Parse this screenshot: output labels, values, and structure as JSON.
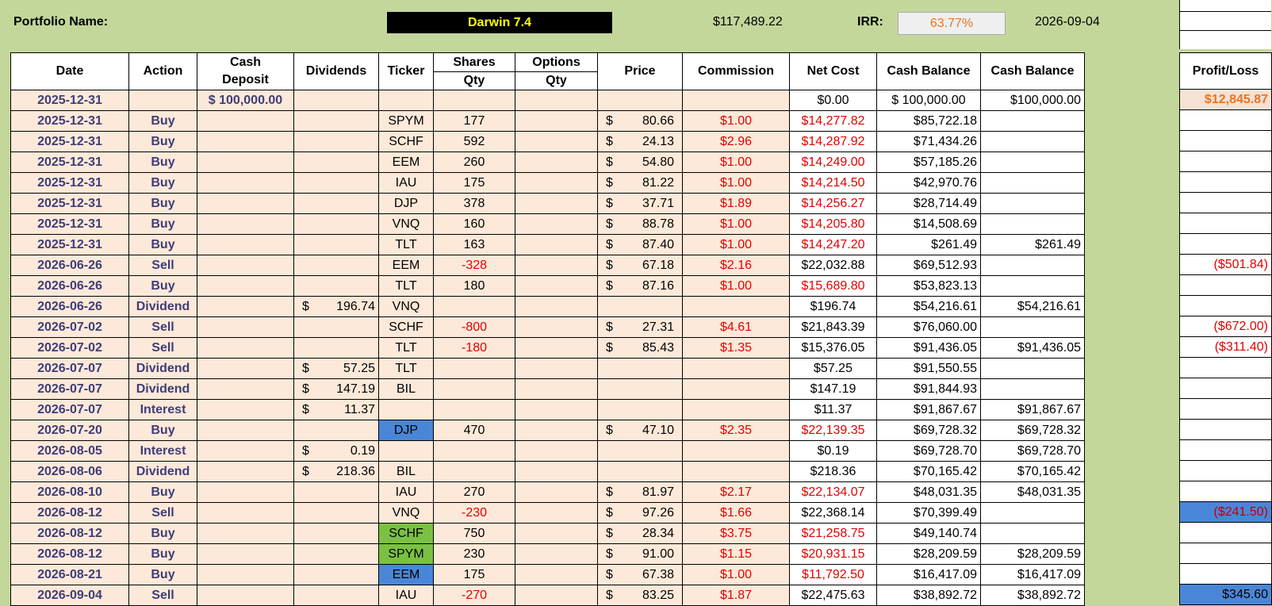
{
  "header": {
    "portfolio_label": "Portfolio Name:",
    "portfolio_name": "Darwin 7.4",
    "total_value": "$117,489.22",
    "irr_label": "IRR:",
    "irr_value": "63.77%",
    "report_date": "2026-09-04"
  },
  "columns": {
    "date": "Date",
    "action": "Action",
    "cash_deposit_1": "Cash",
    "cash_deposit_2": "Deposit",
    "dividends": "Dividends",
    "ticker": "Ticker",
    "shares_1": "Shares",
    "shares_2": "Qty",
    "options_1": "Options",
    "options_2": "Qty",
    "price": "Price",
    "commission": "Commission",
    "net_cost": "Net Cost",
    "cash_balance_1": "Cash Balance",
    "cash_balance_2": "Cash Balance",
    "profit_loss": "Profit/Loss"
  },
  "currency_symbol": "$",
  "rows": [
    {
      "date": "2025-12-31",
      "action": "",
      "deposit": "$ 100,000.00",
      "div": "",
      "ticker": "",
      "shares": "",
      "options": "",
      "price": "",
      "commission": "",
      "net_cost": "$0.00",
      "cash1": "$  100,000.00",
      "cash2": "$100,000.00",
      "pl": "$12,845.87"
    },
    {
      "date": "2025-12-31",
      "action": "Buy",
      "deposit": "",
      "div": "",
      "ticker": "SPYM",
      "shares": "177",
      "options": "",
      "price": "80.66",
      "commission": "$1.00",
      "net_cost": "$14,277.82",
      "cash1": "$85,722.18",
      "cash2": "",
      "pl": ""
    },
    {
      "date": "2025-12-31",
      "action": "Buy",
      "deposit": "",
      "div": "",
      "ticker": "SCHF",
      "shares": "592",
      "options": "",
      "price": "24.13",
      "commission": "$2.96",
      "net_cost": "$14,287.92",
      "cash1": "$71,434.26",
      "cash2": "",
      "pl": ""
    },
    {
      "date": "2025-12-31",
      "action": "Buy",
      "deposit": "",
      "div": "",
      "ticker": "EEM",
      "shares": "260",
      "options": "",
      "price": "54.80",
      "commission": "$1.00",
      "net_cost": "$14,249.00",
      "cash1": "$57,185.26",
      "cash2": "",
      "pl": ""
    },
    {
      "date": "2025-12-31",
      "action": "Buy",
      "deposit": "",
      "div": "",
      "ticker": "IAU",
      "shares": "175",
      "options": "",
      "price": "81.22",
      "commission": "$1.00",
      "net_cost": "$14,214.50",
      "cash1": "$42,970.76",
      "cash2": "",
      "pl": ""
    },
    {
      "date": "2025-12-31",
      "action": "Buy",
      "deposit": "",
      "div": "",
      "ticker": "DJP",
      "shares": "378",
      "options": "",
      "price": "37.71",
      "commission": "$1.89",
      "net_cost": "$14,256.27",
      "cash1": "$28,714.49",
      "cash2": "",
      "pl": ""
    },
    {
      "date": "2025-12-31",
      "action": "Buy",
      "deposit": "",
      "div": "",
      "ticker": "VNQ",
      "shares": "160",
      "options": "",
      "price": "88.78",
      "commission": "$1.00",
      "net_cost": "$14,205.80",
      "cash1": "$14,508.69",
      "cash2": "",
      "pl": ""
    },
    {
      "date": "2025-12-31",
      "action": "Buy",
      "deposit": "",
      "div": "",
      "ticker": "TLT",
      "shares": "163",
      "options": "",
      "price": "87.40",
      "commission": "$1.00",
      "net_cost": "$14,247.20",
      "cash1": "$261.49",
      "cash2": "$261.49",
      "pl": ""
    },
    {
      "date": "2026-06-26",
      "action": "Sell",
      "deposit": "",
      "div": "",
      "ticker": "EEM",
      "shares": "-328",
      "options": "",
      "price": "67.18",
      "commission": "$2.16",
      "net_cost": "$22,032.88",
      "cash1": "$69,512.93",
      "cash2": "",
      "pl": "($501.84)"
    },
    {
      "date": "2026-06-26",
      "action": "Buy",
      "deposit": "",
      "div": "",
      "ticker": "TLT",
      "shares": "180",
      "options": "",
      "price": "87.16",
      "commission": "$1.00",
      "net_cost": "$15,689.80",
      "cash1": "$53,823.13",
      "cash2": "",
      "pl": ""
    },
    {
      "date": "2026-06-26",
      "action": "Dividend",
      "deposit": "",
      "div": "196.74",
      "ticker": "VNQ",
      "shares": "",
      "options": "",
      "price": "",
      "commission": "",
      "net_cost": "$196.74",
      "cash1": "$54,216.61",
      "cash2": "$54,216.61",
      "pl": ""
    },
    {
      "date": "2026-07-02",
      "action": "Sell",
      "deposit": "",
      "div": "",
      "ticker": "SCHF",
      "shares": "-800",
      "options": "",
      "price": "27.31",
      "commission": "$4.61",
      "net_cost": "$21,843.39",
      "cash1": "$76,060.00",
      "cash2": "",
      "pl": "($672.00)"
    },
    {
      "date": "2026-07-02",
      "action": "Sell",
      "deposit": "",
      "div": "",
      "ticker": "TLT",
      "shares": "-180",
      "options": "",
      "price": "85.43",
      "commission": "$1.35",
      "net_cost": "$15,376.05",
      "cash1": "$91,436.05",
      "cash2": "$91,436.05",
      "pl": "($311.40)"
    },
    {
      "date": "2026-07-07",
      "action": "Dividend",
      "deposit": "",
      "div": "57.25",
      "ticker": "TLT",
      "shares": "",
      "options": "",
      "price": "",
      "commission": "",
      "net_cost": "$57.25",
      "cash1": "$91,550.55",
      "cash2": "",
      "pl": ""
    },
    {
      "date": "2026-07-07",
      "action": "Dividend",
      "deposit": "",
      "div": "147.19",
      "ticker": "BIL",
      "shares": "",
      "options": "",
      "price": "",
      "commission": "",
      "net_cost": "$147.19",
      "cash1": "$91,844.93",
      "cash2": "",
      "pl": ""
    },
    {
      "date": "2026-07-07",
      "action": "Interest",
      "deposit": "",
      "div": "11.37",
      "ticker": "",
      "shares": "",
      "options": "",
      "price": "",
      "commission": "",
      "net_cost": "$11.37",
      "cash1": "$91,867.67",
      "cash2": "$91,867.67",
      "pl": ""
    },
    {
      "date": "2026-07-20",
      "action": "Buy",
      "deposit": "",
      "div": "",
      "ticker": "DJP",
      "shares": "470",
      "options": "",
      "price": "47.10",
      "commission": "$2.35",
      "net_cost": "$22,139.35",
      "cash1": "$69,728.32",
      "cash2": "$69,728.32",
      "pl": ""
    },
    {
      "date": "2026-08-05",
      "action": "Interest",
      "deposit": "",
      "div": "0.19",
      "ticker": "",
      "shares": "",
      "options": "",
      "price": "",
      "commission": "",
      "net_cost": "$0.19",
      "cash1": "$69,728.70",
      "cash2": "$69,728.70",
      "pl": ""
    },
    {
      "date": "2026-08-06",
      "action": "Dividend",
      "deposit": "",
      "div": "218.36",
      "ticker": "BIL",
      "shares": "",
      "options": "",
      "price": "",
      "commission": "",
      "net_cost": "$218.36",
      "cash1": "$70,165.42",
      "cash2": "$70,165.42",
      "pl": ""
    },
    {
      "date": "2026-08-10",
      "action": "Buy",
      "deposit": "",
      "div": "",
      "ticker": "IAU",
      "shares": "270",
      "options": "",
      "price": "81.97",
      "commission": "$2.17",
      "net_cost": "$22,134.07",
      "cash1": "$48,031.35",
      "cash2": "$48,031.35",
      "pl": ""
    },
    {
      "date": "2026-08-12",
      "action": "Sell",
      "deposit": "",
      "div": "",
      "ticker": "VNQ",
      "shares": "-230",
      "options": "",
      "price": "97.26",
      "commission": "$1.66",
      "net_cost": "$22,368.14",
      "cash1": "$70,399.49",
      "cash2": "",
      "pl": "($241.50)"
    },
    {
      "date": "2026-08-12",
      "action": "Buy",
      "deposit": "",
      "div": "",
      "ticker": "SCHF",
      "shares": "750",
      "options": "",
      "price": "28.34",
      "commission": "$3.75",
      "net_cost": "$21,258.75",
      "cash1": "$49,140.74",
      "cash2": "",
      "pl": ""
    },
    {
      "date": "2026-08-12",
      "action": "Buy",
      "deposit": "",
      "div": "",
      "ticker": "SPYM",
      "shares": "230",
      "options": "",
      "price": "91.00",
      "commission": "$1.15",
      "net_cost": "$20,931.15",
      "cash1": "$28,209.59",
      "cash2": "$28,209.59",
      "pl": ""
    },
    {
      "date": "2026-08-21",
      "action": "Buy",
      "deposit": "",
      "div": "",
      "ticker": "EEM",
      "shares": "175",
      "options": "",
      "price": "67.38",
      "commission": "$1.00",
      "net_cost": "$11,792.50",
      "cash1": "$16,417.09",
      "cash2": "$16,417.09",
      "pl": ""
    },
    {
      "date": "2026-09-04",
      "action": "Sell",
      "deposit": "",
      "div": "",
      "ticker": "IAU",
      "shares": "-270",
      "options": "",
      "price": "83.25",
      "commission": "$1.87",
      "net_cost": "$22,475.63",
      "cash1": "$38,892.72",
      "cash2": "$38,892.72",
      "pl": "$345.60"
    }
  ],
  "styles": {
    "ticker_highlight": {
      "16": "blue",
      "21": "green",
      "22": "green",
      "23": "blue"
    },
    "pl_highlight": {
      "0": "orange",
      "20": "blue-red",
      "24": "blue"
    },
    "white_net_cost_rows": [
      0,
      8,
      10,
      11,
      12,
      13,
      14,
      15,
      17,
      18,
      20,
      24
    ],
    "white_cash_rows": "all"
  }
}
